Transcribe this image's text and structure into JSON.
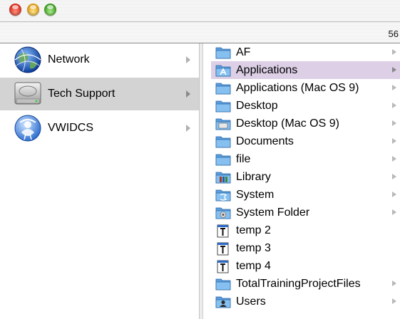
{
  "window": {
    "status_text": "56"
  },
  "column1": {
    "items": [
      {
        "label": "Network",
        "icon": "network-globe-icon",
        "has_submenu": true,
        "selected": false
      },
      {
        "label": "Tech Support",
        "icon": "hard-drive-icon",
        "has_submenu": true,
        "selected": true
      },
      {
        "label": "VWIDCS",
        "icon": "network-user-icon",
        "has_submenu": true,
        "selected": false
      }
    ]
  },
  "column3": {
    "items": [
      {
        "label": "AF",
        "icon": "folder-icon",
        "has_submenu": true
      },
      {
        "label": "Applications",
        "icon": "applications-folder-icon",
        "has_submenu": true,
        "selected": true
      },
      {
        "label": "Applications (Mac OS 9)",
        "icon": "folder-icon",
        "has_submenu": true
      },
      {
        "label": "Desktop",
        "icon": "folder-icon",
        "has_submenu": true
      },
      {
        "label": "Desktop (Mac OS 9)",
        "icon": "desktop-folder-icon",
        "has_submenu": true
      },
      {
        "label": "Documents",
        "icon": "folder-icon",
        "has_submenu": true
      },
      {
        "label": "file",
        "icon": "folder-icon",
        "has_submenu": true
      },
      {
        "label": "Library",
        "icon": "library-folder-icon",
        "has_submenu": true
      },
      {
        "label": "System",
        "icon": "system-folder-icon",
        "has_submenu": true
      },
      {
        "label": "System Folder",
        "icon": "system-folder-os9-icon",
        "has_submenu": true
      },
      {
        "label": "temp 2",
        "icon": "text-document-icon",
        "has_submenu": false
      },
      {
        "label": "temp 3",
        "icon": "text-document-icon",
        "has_submenu": false
      },
      {
        "label": "temp 4",
        "icon": "text-document-icon",
        "has_submenu": false
      },
      {
        "label": "TotalTrainingProjectFiles",
        "icon": "folder-icon",
        "has_submenu": true
      },
      {
        "label": "Users",
        "icon": "users-folder-icon",
        "has_submenu": true
      }
    ]
  },
  "colors": {
    "selection_column1": "#d3d3d3",
    "selection_column3": "#dccfe6"
  }
}
